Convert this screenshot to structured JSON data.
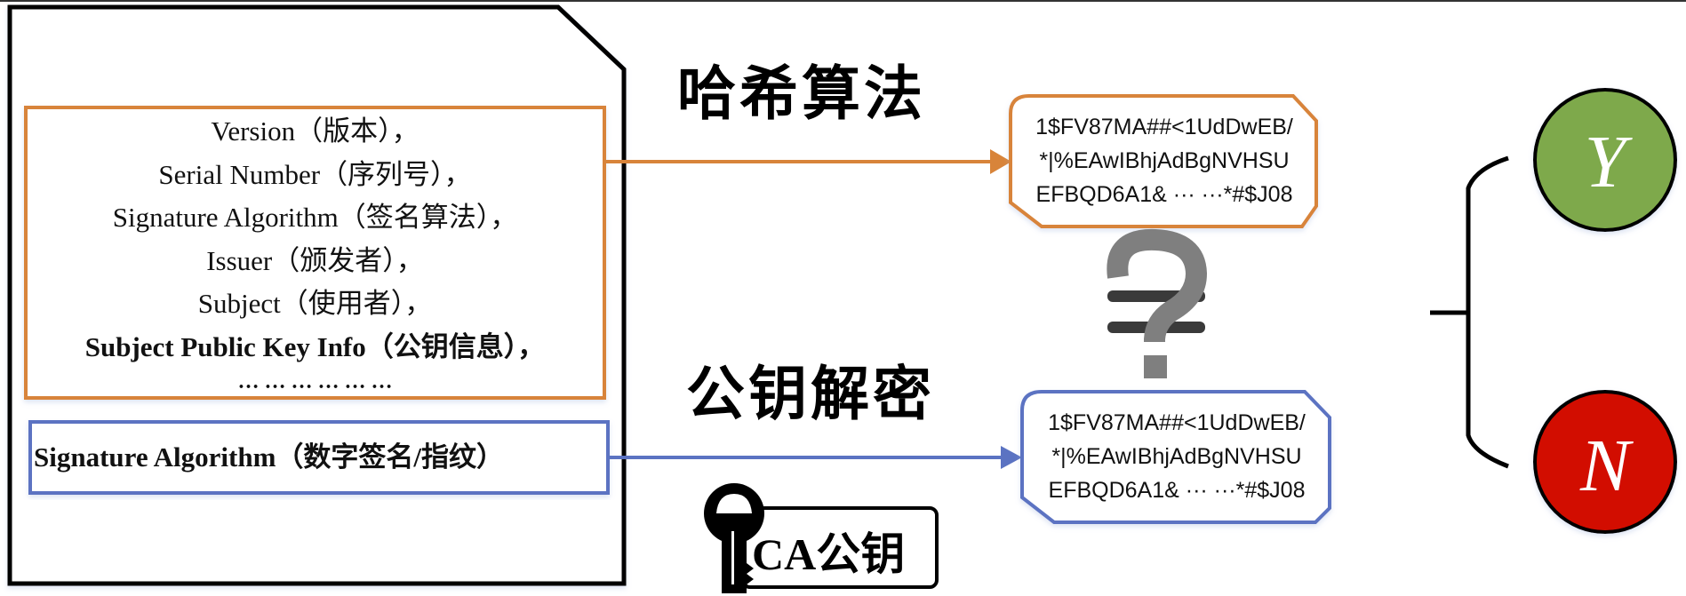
{
  "certificate": {
    "fields": [
      {
        "label": "Version（版本），",
        "bold": false
      },
      {
        "label": "Serial Number（序列号），",
        "bold": false
      },
      {
        "label": "Signature Algorithm（签名算法），",
        "bold": false
      },
      {
        "label": "Issuer（颁发者），",
        "bold": false
      },
      {
        "label": "Subject（使用者），",
        "bold": false
      },
      {
        "label": "Subject Public Key Info（公钥信息），",
        "bold": true
      },
      {
        "label": "… …    … …    … …",
        "bold": true
      }
    ],
    "signature_label": "Signature Algorithm（数字签名/指纹）"
  },
  "steps": {
    "hash_title": "哈希算法",
    "decrypt_title": "公钥解密"
  },
  "digests": {
    "computed": {
      "lines": [
        "1$FV87MA##<1UdDwEB/",
        "*|%EAwIBhjAdBgNVHSU",
        "EFBQD6A1& ··· ···*#$J08"
      ]
    },
    "decrypted": {
      "lines": [
        "1$FV87MA##<1UdDwEB/",
        "*|%EAwIBhjAdBgNVHSU",
        "EFBQD6A1& ··· ···*#$J08"
      ]
    }
  },
  "compare": {
    "symbol": "?",
    "icon": "not-equal-question-icon"
  },
  "key": {
    "label": "CA公钥",
    "icon": "key-icon"
  },
  "results": {
    "yes": {
      "label": "Y",
      "color": "#7ea94b"
    },
    "no": {
      "label": "N",
      "color": "#d20d03"
    }
  },
  "colors": {
    "hash_path": "#d8843a",
    "decrypt_path": "#5b73c2",
    "outline": "#000000",
    "compare_q": "#7f7f7f",
    "compare_eq": "#3a3a3a"
  }
}
